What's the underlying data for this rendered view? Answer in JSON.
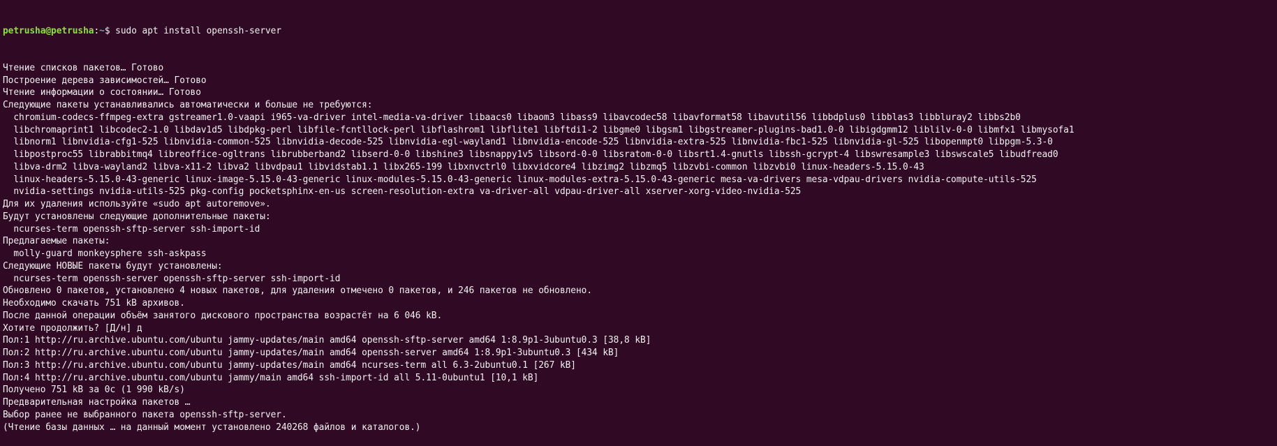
{
  "prompt": {
    "user_host": "petrusha@petrusha",
    "sep": ":",
    "path": "~",
    "symbol": "$ ",
    "command": "sudo apt install openssh-server"
  },
  "colors": {
    "background": "#300a24",
    "prompt_user": "#8ae234",
    "prompt_path": "#729fcf",
    "text": "#f2f2f2"
  },
  "output": [
    "Чтение списков пакетов… Готово",
    "Построение дерева зависимостей… Готово",
    "Чтение информации о состоянии… Готово",
    "Следующие пакеты устанавливались автоматически и больше не требуются:",
    "  chromium-codecs-ffmpeg-extra gstreamer1.0-vaapi i965-va-driver intel-media-va-driver libaacs0 libaom3 libass9 libavcodec58 libavformat58 libavutil56 libbdplus0 libblas3 libbluray2 libbs2b0",
    "  libchromaprint1 libcodec2-1.0 libdav1d5 libdpkg-perl libfile-fcntllock-perl libflashrom1 libflite1 libftdi1-2 libgme0 libgsm1 libgstreamer-plugins-bad1.0-0 libigdgmm12 liblilv-0-0 libmfx1 libmysofa1",
    "  libnorm1 libnvidia-cfg1-525 libnvidia-common-525 libnvidia-decode-525 libnvidia-egl-wayland1 libnvidia-encode-525 libnvidia-extra-525 libnvidia-fbc1-525 libnvidia-gl-525 libopenmpt0 libpgm-5.3-0",
    "  libpostproc55 librabbitmq4 libreoffice-ogltrans librubberband2 libserd-0-0 libshine3 libsnappy1v5 libsord-0-0 libsratom-0-0 libsrt1.4-gnutls libssh-gcrypt-4 libswresample3 libswscale5 libudfread0",
    "  libva-drm2 libva-wayland2 libva-x11-2 libva2 libvdpau1 libvidstab1.1 libx265-199 libxnvctrl0 libxvidcore4 libzimg2 libzmq5 libzvbi-common libzvbi0 linux-headers-5.15.0-43",
    "  linux-headers-5.15.0-43-generic linux-image-5.15.0-43-generic linux-modules-5.15.0-43-generic linux-modules-extra-5.15.0-43-generic mesa-va-drivers mesa-vdpau-drivers nvidia-compute-utils-525",
    "  nvidia-settings nvidia-utils-525 pkg-config pocketsphinx-en-us screen-resolution-extra va-driver-all vdpau-driver-all xserver-xorg-video-nvidia-525",
    "Для их удаления используйте «sudo apt autoremove».",
    "Будут установлены следующие дополнительные пакеты:",
    "  ncurses-term openssh-sftp-server ssh-import-id",
    "Предлагаемые пакеты:",
    "  molly-guard monkeysphere ssh-askpass",
    "Следующие НОВЫЕ пакеты будут установлены:",
    "  ncurses-term openssh-server openssh-sftp-server ssh-import-id",
    "Обновлено 0 пакетов, установлено 4 новых пакетов, для удаления отмечено 0 пакетов, и 246 пакетов не обновлено.",
    "Необходимо скачать 751 kB архивов.",
    "После данной операции объём занятого дискового пространства возрастёт на 6 046 kB.",
    "Хотите продолжить? [Д/н] д",
    "Пол:1 http://ru.archive.ubuntu.com/ubuntu jammy-updates/main amd64 openssh-sftp-server amd64 1:8.9p1-3ubuntu0.3 [38,8 kB]",
    "Пол:2 http://ru.archive.ubuntu.com/ubuntu jammy-updates/main amd64 openssh-server amd64 1:8.9p1-3ubuntu0.3 [434 kB]",
    "Пол:3 http://ru.archive.ubuntu.com/ubuntu jammy-updates/main amd64 ncurses-term all 6.3-2ubuntu0.1 [267 kB]",
    "Пол:4 http://ru.archive.ubuntu.com/ubuntu jammy/main amd64 ssh-import-id all 5.11-0ubuntu1 [10,1 kB]",
    "Получено 751 kB за 0c (1 990 kB/s)",
    "Предварительная настройка пакетов …",
    "Выбор ранее не выбранного пакета openssh-sftp-server.",
    "(Чтение базы данных … на данный момент установлено 240268 файлов и каталогов.)"
  ]
}
